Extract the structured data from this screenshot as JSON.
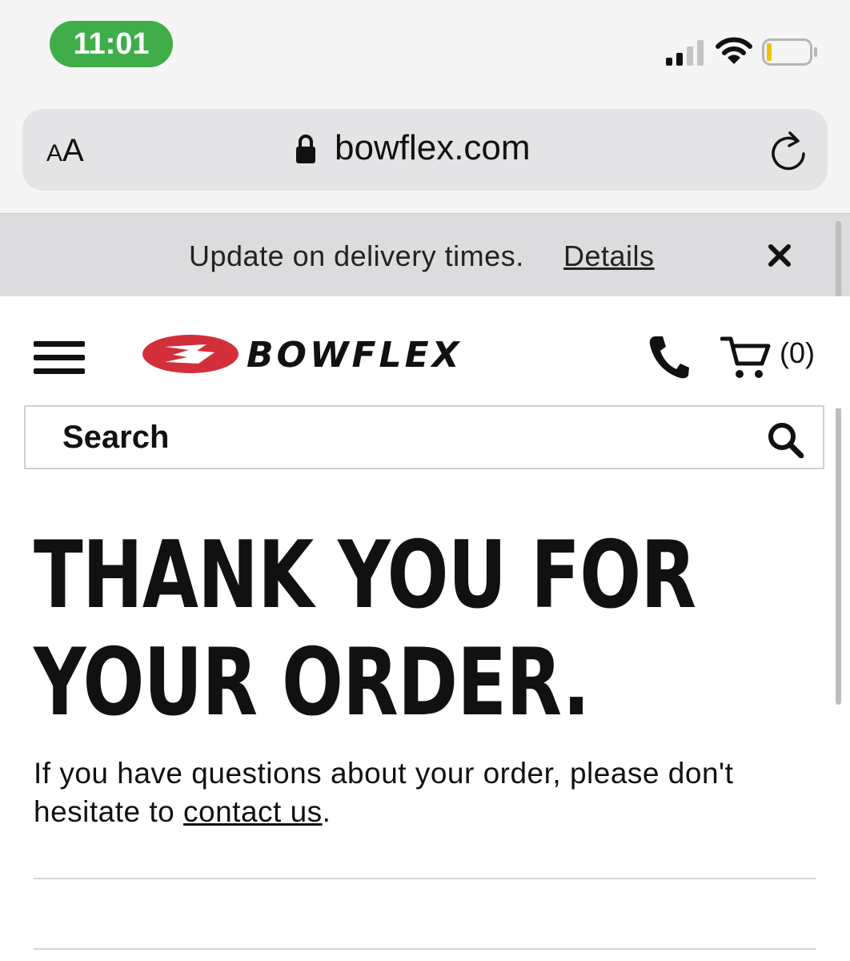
{
  "status_bar": {
    "time": "11:01",
    "time_pill_color": "#3fae49"
  },
  "browser": {
    "text_size_label_small": "A",
    "text_size_label_large": "A",
    "domain": "bowflex.com",
    "icons": [
      "lock-icon",
      "reload-icon"
    ]
  },
  "notice": {
    "text": "Update on delivery times.",
    "link": "Details",
    "close_icon": "close-icon"
  },
  "header": {
    "brand": "BOWFLEX",
    "brand_color": "#d32f3a",
    "cart_count": "(0)",
    "icons": [
      "menu-icon",
      "phone-icon",
      "cart-icon"
    ]
  },
  "search": {
    "placeholder": "Search"
  },
  "main": {
    "title": "THANK YOU FOR YOUR ORDER.",
    "message_prefix": "If you have questions about your order, please don't hesitate to ",
    "message_link": "contact us",
    "message_suffix": "."
  }
}
